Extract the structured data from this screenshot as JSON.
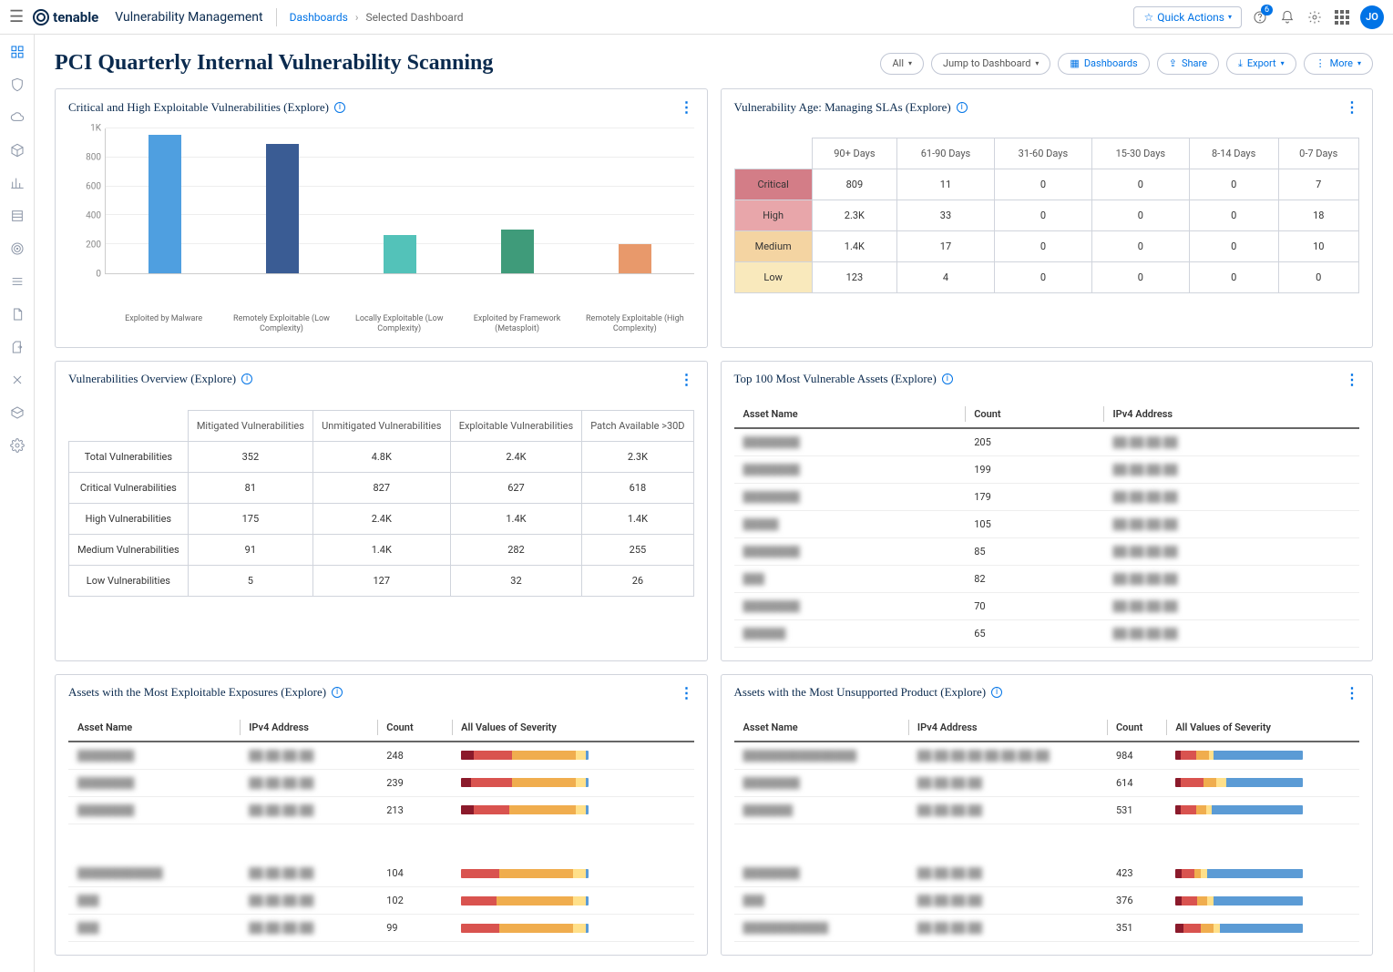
{
  "header": {
    "logo_text": "tenable",
    "product_name": "Vulnerability Management",
    "breadcrumb_root": "Dashboards",
    "breadcrumb_current": "Selected Dashboard",
    "quick_actions": "Quick Actions",
    "notification_count": "6",
    "avatar_initials": "JO"
  },
  "page": {
    "title": "PCI Quarterly Internal Vulnerability Scanning",
    "actions": {
      "all": "All",
      "jump": "Jump to Dashboard",
      "dashboards": "Dashboards",
      "share": "Share",
      "export": "Export",
      "more": "More"
    }
  },
  "widgets": {
    "bar_chart": {
      "title": "Critical and High Exploitable Vulnerabilities (Explore)"
    },
    "sla": {
      "title": "Vulnerability Age: Managing SLAs (Explore)"
    },
    "overview": {
      "title": "Vulnerabilities Overview (Explore)"
    },
    "top100": {
      "title": "Top 100 Most Vulnerable Assets (Explore)"
    },
    "exploitable": {
      "title": "Assets with the Most Exploitable Exposures (Explore)"
    },
    "unsupported": {
      "title": "Assets with the Most Unsupported Product (Explore)"
    }
  },
  "chart_data": {
    "type": "bar",
    "title": "Critical and High Exploitable Vulnerabilities (Explore)",
    "ylabel": "",
    "ylim": [
      0,
      1000
    ],
    "y_ticks": [
      "1K",
      "800",
      "600",
      "400",
      "200",
      "0"
    ],
    "categories": [
      "Exploited by Malware",
      "Remotely Exploitable (Low Complexity)",
      "Locally Exploitable (Low Complexity)",
      "Exploited by Framework (Metasploit)",
      "Remotely Exploitable (High Complexity)"
    ],
    "series": [
      {
        "name": "Count",
        "values": [
          950,
          890,
          265,
          300,
          200
        ],
        "colors": [
          "#4f9fe0",
          "#3a5c94",
          "#53c2b9",
          "#3f9b7a",
          "#e8996b"
        ]
      }
    ]
  },
  "sla_table": {
    "columns": [
      "90+ Days",
      "61-90 Days",
      "31-60 Days",
      "15-30 Days",
      "8-14 Days",
      "0-7 Days"
    ],
    "rows": [
      {
        "label": "Critical",
        "class": "sev-critical",
        "values": [
          "809",
          "11",
          "0",
          "0",
          "0",
          "7"
        ]
      },
      {
        "label": "High",
        "class": "sev-high",
        "values": [
          "2.3K",
          "33",
          "0",
          "0",
          "0",
          "18"
        ]
      },
      {
        "label": "Medium",
        "class": "sev-medium",
        "values": [
          "1.4K",
          "17",
          "0",
          "0",
          "0",
          "10"
        ]
      },
      {
        "label": "Low",
        "class": "sev-low",
        "values": [
          "123",
          "4",
          "0",
          "0",
          "0",
          "0"
        ]
      }
    ]
  },
  "overview_table": {
    "columns": [
      "Mitigated Vulnerabilities",
      "Unmitigated Vulnerabilities",
      "Exploitable Vulnerabilities",
      "Patch Available >30D"
    ],
    "rows": [
      {
        "label": "Total Vulnerabilities",
        "values": [
          "352",
          "4.8K",
          "2.4K",
          "2.3K"
        ]
      },
      {
        "label": "Critical Vulnerabilities",
        "values": [
          "81",
          "827",
          "627",
          "618"
        ]
      },
      {
        "label": "High Vulnerabilities",
        "values": [
          "175",
          "2.4K",
          "1.4K",
          "1.4K"
        ]
      },
      {
        "label": "Medium Vulnerabilities",
        "values": [
          "91",
          "1.4K",
          "282",
          "255"
        ]
      },
      {
        "label": "Low Vulnerabilities",
        "values": [
          "5",
          "127",
          "32",
          "26"
        ]
      }
    ]
  },
  "top100": {
    "columns": [
      "Asset Name",
      "Count",
      "IPv4 Address"
    ],
    "rows": [
      {
        "name": "████████",
        "count": "205",
        "ip": "██.██.██.██"
      },
      {
        "name": "████████",
        "count": "199",
        "ip": "██.██.██.██"
      },
      {
        "name": "████████",
        "count": "179",
        "ip": "██.██.██.██"
      },
      {
        "name": "█████",
        "count": "105",
        "ip": "██.██.██.██"
      },
      {
        "name": "████████",
        "count": "85",
        "ip": "██.██.██.██"
      },
      {
        "name": "███",
        "count": "82",
        "ip": "██.██.██.██"
      },
      {
        "name": "████████",
        "count": "70",
        "ip": "██.██.██.██"
      },
      {
        "name": "██████",
        "count": "65",
        "ip": "██.██.██.██"
      }
    ]
  },
  "exploitable": {
    "columns": [
      "Asset Name",
      "IPv4 Address",
      "Count",
      "All Values of Severity"
    ],
    "rows": [
      {
        "name": "████████",
        "ip": "██.██.██.██",
        "count": "248",
        "sev": [
          10,
          30,
          50,
          8,
          2
        ]
      },
      {
        "name": "████████",
        "ip": "██.██.██.██",
        "count": "239",
        "sev": [
          8,
          32,
          50,
          8,
          2
        ]
      },
      {
        "name": "████████",
        "ip": "██.██.██.██",
        "count": "213",
        "sev": [
          10,
          28,
          52,
          8,
          2
        ]
      },
      {
        "name": "████████████",
        "ip": "██.██.██.██",
        "count": "104",
        "sev": [
          0,
          30,
          58,
          10,
          2
        ]
      },
      {
        "name": "███",
        "ip": "██.██.██.██",
        "count": "102",
        "sev": [
          0,
          28,
          60,
          10,
          2
        ]
      },
      {
        "name": "███",
        "ip": "██.██.██.██",
        "count": "99",
        "sev": [
          0,
          30,
          58,
          10,
          2
        ]
      }
    ]
  },
  "unsupported": {
    "columns": [
      "Asset Name",
      "IPv4 Address",
      "Count",
      "All Values of Severity"
    ],
    "rows": [
      {
        "name": "████████████████",
        "ip": "██.██.██.██ ██.██.██.██",
        "count": "984",
        "sev": [
          4,
          12,
          10,
          4,
          70
        ]
      },
      {
        "name": "████████",
        "ip": "██.██.██.██",
        "count": "614",
        "sev": [
          4,
          18,
          10,
          8,
          60
        ]
      },
      {
        "name": "███████",
        "ip": "██.██.██.██",
        "count": "531",
        "sev": [
          4,
          12,
          8,
          4,
          72
        ]
      },
      {
        "name": "████████",
        "ip": "██.██.██.██",
        "count": "423",
        "sev": [
          5,
          10,
          5,
          5,
          75
        ]
      },
      {
        "name": "███",
        "ip": "██.██.██.██",
        "count": "376",
        "sev": [
          5,
          12,
          8,
          5,
          70
        ]
      },
      {
        "name": "████████████",
        "ip": "██.██.██.██",
        "count": "351",
        "sev": [
          6,
          14,
          10,
          5,
          65
        ]
      }
    ]
  }
}
